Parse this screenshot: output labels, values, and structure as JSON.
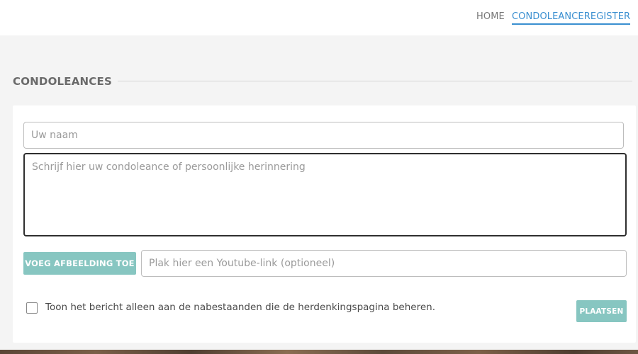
{
  "nav": {
    "home_label": "HOME",
    "register_label": "CONDOLEANCEREGISTER",
    "accent_color": "#3a8fd0"
  },
  "section": {
    "heading": "CONDOLEANCES"
  },
  "form": {
    "name_placeholder": "Uw naam",
    "message_placeholder": "Schrijf hier uw condoleance of persoonlijke herinnering",
    "add_image_label": "VOEG AFBEELDING TOE",
    "youtube_placeholder": "Plak hier een Youtube-link (optioneel)",
    "private_checkbox_label": "Toon het bericht alleen aan de nabestaanden die de herdenkingspagina beheren.",
    "private_checked": false,
    "submit_label": "PLAATSEN",
    "button_color": "#87c6c1"
  }
}
